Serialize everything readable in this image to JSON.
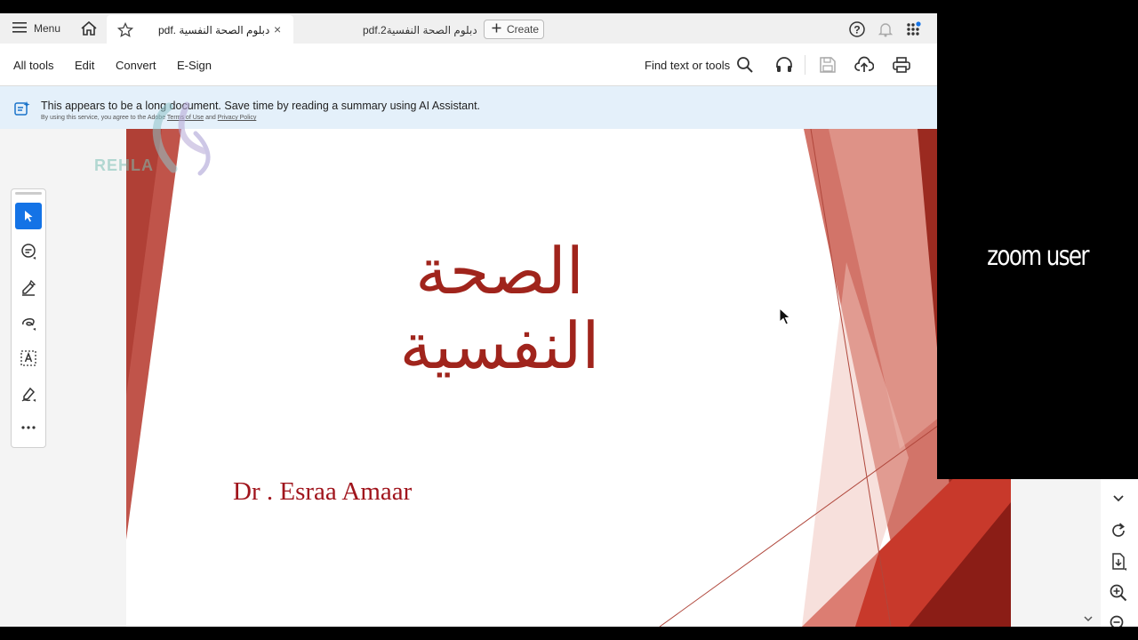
{
  "tabbar": {
    "menu_label": "Menu",
    "active_tab_title": "pdf. دبلوم الصحة النفسية",
    "second_tab_title": "pdf.2دبلوم الصحة النفسية",
    "close_glyph": "×",
    "create_label": "Create"
  },
  "toolbar": {
    "all_tools": "All tools",
    "edit": "Edit",
    "convert": "Convert",
    "esign": "E-Sign",
    "find": "Find text or tools"
  },
  "banner": {
    "message": "This appears to be a long document. Save time by reading a summary using AI Assistant.",
    "fine_prefix": "By using this service, you agree to the Adobe",
    "terms": "Terms of Use",
    "and": "and",
    "privacy": "Privacy Policy"
  },
  "slide": {
    "title": "الصحة النفسية",
    "author": "Dr . Esraa Amaar",
    "colors": {
      "title": "#a0241c",
      "accent_dark": "#8b1d16",
      "accent_mid": "#c8392b",
      "accent_light": "#e8a79c"
    }
  },
  "watermark": {
    "text": "REHLA"
  },
  "zoom": {
    "participant_name": "zoom user"
  },
  "left_tools": [
    "select-icon",
    "comment-icon",
    "highlight-icon",
    "draw-icon",
    "text-select-icon",
    "sign-icon",
    "more-icon"
  ],
  "right_tools": [
    "chevron-down-icon",
    "rotate-icon",
    "page-extract-icon",
    "zoom-in-icon",
    "zoom-out-icon"
  ],
  "colors": {
    "accent": "#1473e6",
    "banner_bg": "#e4f0fa"
  }
}
